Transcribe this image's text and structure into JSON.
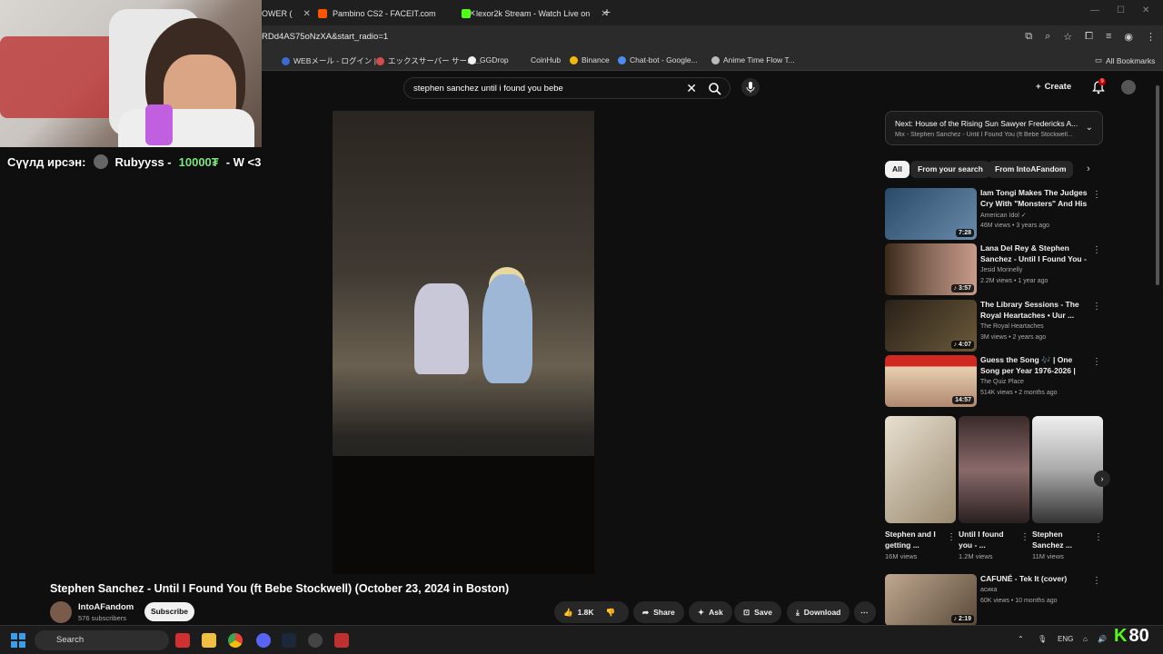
{
  "browser": {
    "tabs": [
      {
        "label": "OWER (",
        "color": "#888888"
      },
      {
        "label": "Pambino CS2 - FACEIT.com",
        "color": "#ff5500"
      },
      {
        "label": "lexor2k Stream - Watch Live on",
        "color": "#53fc18"
      }
    ],
    "new_tab": "+",
    "url": "RDd4AS75oNzXA&start_radio=1",
    "bookmarks": [
      {
        "label": "WEBメール - ログイン |...",
        "color": "#3a6ccf"
      },
      {
        "label": "エックスサーバー サーバ...",
        "color": "#d94a4a"
      },
      {
        "label": "GGDrop",
        "color": "#f1f1f1"
      },
      {
        "label": "CoinHub",
        "color": "#2b2b2b"
      },
      {
        "label": "Binance",
        "color": "#f0b90b"
      },
      {
        "label": "Chat-bot - Google...",
        "color": "#4a8cf0"
      },
      {
        "label": "Anime Time Flow T...",
        "color": "#bbbbbb"
      }
    ],
    "all_bookmarks": "All Bookmarks"
  },
  "overlay": {
    "prefix": "Сүүлд ирсэн:",
    "donor": "Rubyyss -",
    "amount": "10000₮",
    "message": "- W <3"
  },
  "youtube": {
    "search_value": "stephen sanchez until i found you bebe",
    "create_label": "Create",
    "notif_count": "9",
    "video_title": "Stephen Sanchez - Until I Found You (ft Bebe Stockwell) (October 23, 2024 in Boston)",
    "channel_name": "IntoAFandom",
    "channel_subs": "576 subscribers",
    "subscribe_label": "Subscribe",
    "actions": {
      "likes": "1.8K",
      "share": "Share",
      "ask": "Ask",
      "save": "Save",
      "download": "Download"
    },
    "next": {
      "title": "Next: House of the Rising Sun Sawyer Fredericks A...",
      "subtitle": "Mix - Stephen Sanchez - Until I Found You (ft Bebe Stockwell..."
    },
    "chips": [
      "All",
      "From your search",
      "From IntoAFandom"
    ],
    "recs": [
      {
        "title": "Iam Tongi Makes The Judges Cry With \"Monsters\" And His ...",
        "channel": "American Idol ✓",
        "meta": "46M views • 3 years ago",
        "duration": "7:28",
        "thumb": "#3a5a7a"
      },
      {
        "title": "Lana Del Rey & Stephen Sanchez - Until I Found You - ...",
        "channel": "Jesid Morinelly",
        "meta": "2.2M views • 1 year ago",
        "duration": "♪ 3:57",
        "thumb": "#6a4a3a"
      },
      {
        "title": "The Library Sessions - The Royal Heartaches • Uur ...",
        "channel": "The Royal Heartaches",
        "meta": "3M views • 2 years ago",
        "duration": "♪ 4:07",
        "thumb": "#4a3a2a"
      },
      {
        "title": "Guess the Song 🎶 | One Song per Year 1976-2026 | Music ...",
        "channel": "The Quiz Place",
        "meta": "514K views • 2 months ago",
        "duration": "14:57",
        "thumb": "#c0302a"
      }
    ],
    "shorts": [
      {
        "name": "Stephen and I getting ...",
        "views": "16M views",
        "thumb": "#b8a890"
      },
      {
        "name": "Until I found you - ...",
        "views": "1.2M views",
        "thumb": "#4a3a3a"
      },
      {
        "name": "Stephen Sanchez ...",
        "views": "11M views",
        "thumb": "#d8d8d8"
      }
    ],
    "last_rec": {
      "title": "CAFUNÉ - Tek It (cover)",
      "channel": "асика",
      "meta": "60K views • 10 months ago",
      "duration": "♪ 2:19",
      "thumb": "#8a7a6a"
    }
  },
  "taskbar": {
    "search": "Search",
    "lang": "ENG",
    "kick_count": "80"
  }
}
